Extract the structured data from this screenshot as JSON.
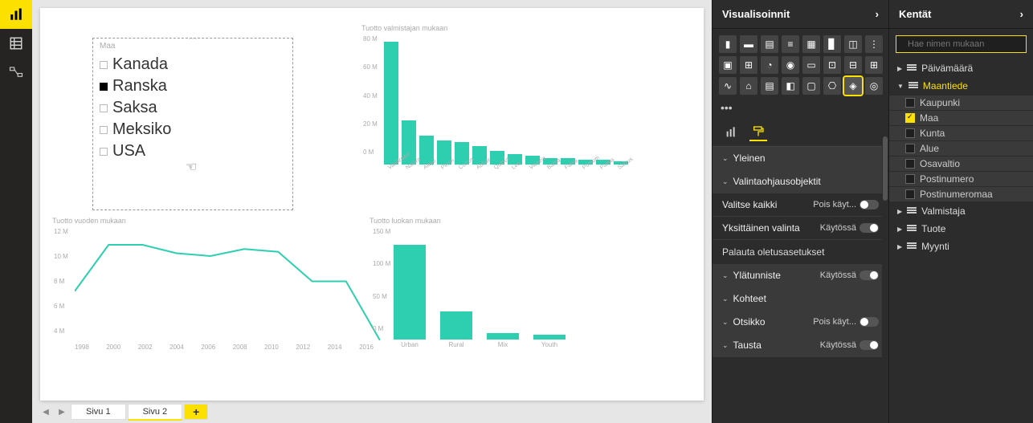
{
  "left_rail": {
    "report": "report-view",
    "data": "data-view",
    "model": "model-view"
  },
  "page_tabs": {
    "tab1": "Sivu 1",
    "tab2": "Sivu 2",
    "add": "+"
  },
  "slicer": {
    "header": "Maa",
    "items": [
      {
        "label": "Kanada",
        "selected": false
      },
      {
        "label": "Ranska",
        "selected": true
      },
      {
        "label": "Saksa",
        "selected": false
      },
      {
        "label": "Meksiko",
        "selected": false
      },
      {
        "label": "USA",
        "selected": false
      }
    ]
  },
  "viz_panel": {
    "title": "Visualisoinnit"
  },
  "format": {
    "section_general": "Yleinen",
    "section_selection": "Valintaohjausobjektit",
    "select_all_label": "Valitse kaikki",
    "select_all_state": "Pois käyt...",
    "single_select_label": "Yksittäinen valinta",
    "single_select_state": "Käytössä",
    "restore_defaults": "Palauta oletusasetukset",
    "header_label": "Ylätunniste",
    "header_state": "Käytössä",
    "items_label": "Kohteet",
    "title_label": "Otsikko",
    "title_state": "Pois käyt...",
    "background_label": "Tausta",
    "background_state": "Käytössä"
  },
  "fields_panel": {
    "title": "Kentät",
    "search_placeholder": "Hae nimen mukaan",
    "groups": {
      "date": "Päivämäärä",
      "geo": "Maantiede",
      "manufacturer": "Valmistaja",
      "product": "Tuote",
      "sales": "Myynti"
    },
    "geo_fields": [
      {
        "label": "Kaupunki",
        "checked": false
      },
      {
        "label": "Maa",
        "checked": true
      },
      {
        "label": "Kunta",
        "checked": false
      },
      {
        "label": "Alue",
        "checked": false
      },
      {
        "label": "Osavaltio",
        "checked": false
      },
      {
        "label": "Postinumero",
        "checked": false
      },
      {
        "label": "Postinumeromaa",
        "checked": false
      }
    ]
  },
  "chart_data": [
    {
      "type": "bar",
      "title": "Tuotto valmistajan mukaan",
      "ylabel": "",
      "xlabel": "",
      "ylim": [
        0,
        80
      ],
      "y_ticks": [
        "80 M",
        "60 M",
        "40 M",
        "20 M",
        "0 M"
      ],
      "categories": [
        "VanArsdel",
        "Natura",
        "Aliqui",
        "Pirum",
        "Currus",
        "Abbas",
        "Quibus",
        "Leo",
        "Victoria",
        "Barba",
        "Fama",
        "Pomum",
        "Palma",
        "Salvus"
      ],
      "values": [
        72,
        26,
        17,
        14,
        13,
        11,
        8,
        6,
        5,
        4,
        4,
        3,
        3,
        2
      ]
    },
    {
      "type": "line",
      "title": "Tuotto vuoden mukaan",
      "ylim": [
        0,
        12
      ],
      "y_ticks": [
        "12 M",
        "10 M",
        "8 M",
        "6 M",
        "4 M"
      ],
      "x": [
        1998,
        2000,
        2002,
        2004,
        2006,
        2008,
        2010,
        2012,
        2014,
        2016
      ],
      "values": [
        7.5,
        10.8,
        10.8,
        10.2,
        10.0,
        10.5,
        10.3,
        8.2,
        8.2,
        4.0
      ]
    },
    {
      "type": "bar",
      "title": "Tuotto luokan mukaan",
      "ylim": [
        0,
        150
      ],
      "y_ticks": [
        "150 M",
        "100 M",
        "50 M",
        "0 M"
      ],
      "categories": [
        "Urban",
        "Rural",
        "Mix",
        "Youth"
      ],
      "values": [
        118,
        35,
        8,
        6
      ]
    }
  ]
}
